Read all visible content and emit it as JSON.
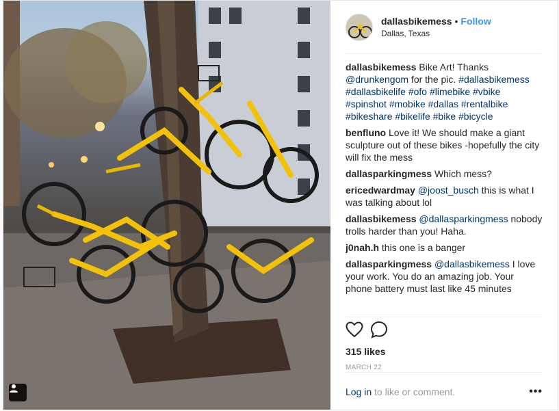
{
  "header": {
    "username": "dallasbikemess",
    "separator": "•",
    "follow_label": "Follow",
    "location": "Dallas, Texas"
  },
  "comments": [
    {
      "user": "dallasbikemess",
      "parts": [
        {
          "t": " Bike Art! Thanks ",
          "link": false
        },
        {
          "t": "@drunkengom",
          "link": true
        },
        {
          "t": " for the pic. ",
          "link": false
        },
        {
          "t": "#dallasbikemess #dallasbikelife #ofo #limebike #vbike #spinshot #mobike #dallas #rentalbike #bikeshare #bikelife #bike #bicycle",
          "link": true
        }
      ]
    },
    {
      "user": "benfluno",
      "parts": [
        {
          "t": " Love it! We should make a giant sculpture out of these bikes -hopefully the city will fix the mess",
          "link": false
        }
      ]
    },
    {
      "user": "dallasparkingmess",
      "parts": [
        {
          "t": " Which mess?",
          "link": false
        }
      ]
    },
    {
      "user": "ericedwardmay",
      "parts": [
        {
          "t": " ",
          "link": false
        },
        {
          "t": "@joost_busch",
          "link": true
        },
        {
          "t": " this is what I was talking about lol",
          "link": false
        }
      ]
    },
    {
      "user": "dallasbikemess",
      "parts": [
        {
          "t": " ",
          "link": false
        },
        {
          "t": "@dallasparkingmess",
          "link": true
        },
        {
          "t": " nobody trolls harder than you! Haha.",
          "link": false
        }
      ]
    },
    {
      "user": "j0nah.h",
      "parts": [
        {
          "t": " this one is a banger",
          "link": false
        }
      ]
    },
    {
      "user": "dallasparkingmess",
      "parts": [
        {
          "t": " ",
          "link": false
        },
        {
          "t": "@dallasbikemess",
          "link": true
        },
        {
          "t": " I love your work. You do an amazing job. Your phone battery must last like 45 minutes",
          "link": false
        }
      ]
    }
  ],
  "actions": {
    "likes": "315 likes",
    "date": "MARCH 22"
  },
  "footer": {
    "login_link": "Log in",
    "login_rest": " to like or comment.",
    "more": "•••"
  },
  "photo": {
    "frame_color": "#f2c20a"
  },
  "icons": {
    "like": "heart-icon",
    "comment": "comment-icon",
    "user_tag": "user-tag-icon",
    "more": "more-options-icon"
  }
}
